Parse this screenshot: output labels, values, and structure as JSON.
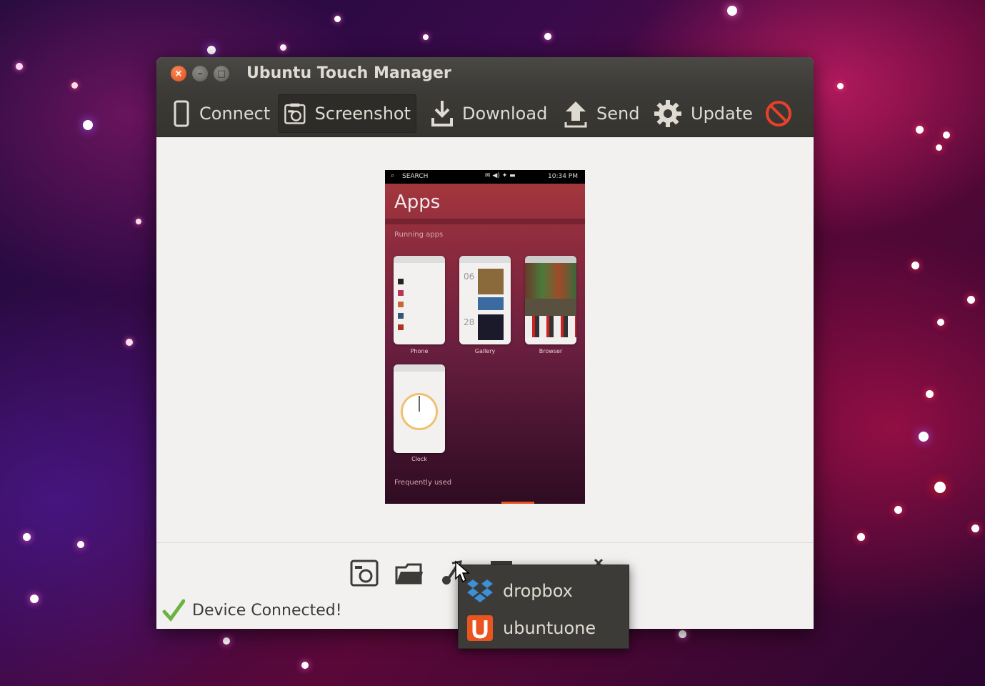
{
  "window": {
    "title": "Ubuntu Touch Manager",
    "controls": [
      "close",
      "minimize",
      "maximize"
    ]
  },
  "toolbar": {
    "items": [
      {
        "label": "Connect",
        "icon": "phone-icon",
        "active": false
      },
      {
        "label": "Screenshot",
        "icon": "camera-icon",
        "active": true
      },
      {
        "label": "Download",
        "icon": "download-icon",
        "active": false
      },
      {
        "label": "Send",
        "icon": "upload-icon",
        "active": false
      },
      {
        "label": "Update",
        "icon": "gear-icon",
        "active": false
      },
      {
        "label": "",
        "icon": "stop-icon",
        "active": false
      }
    ]
  },
  "phone_screen": {
    "status_search": "SEARCH",
    "status_time": "10:34 PM",
    "heading": "Apps",
    "section_running": "Running apps",
    "apps": [
      {
        "label": "Phone"
      },
      {
        "label": "Gallery"
      },
      {
        "label": "Browser"
      },
      {
        "label": "Clock"
      }
    ],
    "section_frequent": "Frequently used"
  },
  "bottom_toolbar": {
    "icons": [
      "take-screenshot-icon",
      "open-folder-icon",
      "share-icon",
      "print-icon",
      "close-icon"
    ]
  },
  "status": {
    "text": "Device Connected!",
    "icon": "checkmark-icon",
    "color": "#6ab33f"
  },
  "share_menu": {
    "items": [
      {
        "label": "dropbox",
        "icon": "dropbox-icon"
      },
      {
        "label": "ubuntuone",
        "icon": "ubuntuone-icon"
      }
    ]
  },
  "colors": {
    "accent": "#e95420",
    "titlebar": "#3c3b37",
    "window_bg": "#f2f1f0"
  }
}
